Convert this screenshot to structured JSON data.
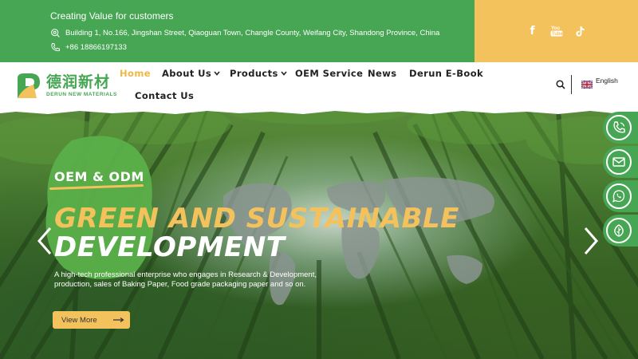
{
  "topbar": {
    "tagline": "Creating Value for customers",
    "address": "Building 1, No.166, Jingshan Street, Qiaoguan Town, Changle County, Weifang City, Shandong Province, China",
    "phone": "+86 18866197133",
    "bg_color": "#47a653",
    "social_bg_color": "#f4c25c",
    "social": [
      {
        "name": "facebook-icon",
        "glyph": "f"
      },
      {
        "name": "youtube-icon",
        "glyph": "▶"
      },
      {
        "name": "tiktok-icon",
        "glyph": "♪"
      }
    ]
  },
  "logo": {
    "cn": "德润新材",
    "en": "DERUN NEW MATERIALS"
  },
  "nav": {
    "items": [
      {
        "label": "Home",
        "active": true
      },
      {
        "label": "About Us",
        "dropdown": true
      },
      {
        "label": "Products",
        "dropdown": true
      },
      {
        "label": "OEM Service"
      },
      {
        "label": "News"
      },
      {
        "label": "Derun E-Book"
      },
      {
        "label": "Contact Us"
      }
    ],
    "chevron": "⌄",
    "language": "English",
    "accent_color": "#f0b845"
  },
  "hero": {
    "kicker": "OEM & ODM",
    "headline_line1": "GREEN AND SUSTAINABLE",
    "headline_line2": "DEVELOPMENT",
    "description": "A high-tech professional enterprise who engages in Research & Development, production, sales of Baking Paper, Food grade packaging paper and so on.",
    "cta_label": "View More",
    "headline_color": "#f4c25c"
  },
  "floating_contacts": [
    {
      "name": "phone-float-icon"
    },
    {
      "name": "email-float-icon"
    },
    {
      "name": "whatsapp-float-icon"
    },
    {
      "name": "leaf-float-icon"
    }
  ]
}
